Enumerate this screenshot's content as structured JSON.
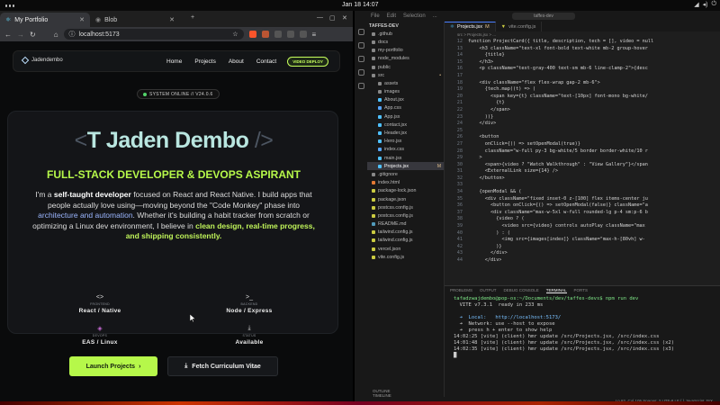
{
  "os": {
    "clock": "Jan 18  14:07"
  },
  "browser": {
    "tabs": [
      {
        "label": "My Portfolio",
        "active": true
      },
      {
        "label": "Blob",
        "active": false
      }
    ],
    "url": "localhost:5173"
  },
  "portfolio": {
    "logo_text": "Jadendembo",
    "nav": [
      "Home",
      "Projects",
      "About",
      "Contact"
    ],
    "nav_cta": "VIDEO DEPLOY",
    "status": "SYSTEM ONLINE // V24.0.6",
    "title_open": "<",
    "title_name": "T Jaden Dembo",
    "title_close": "/>",
    "subtitle": "FULL-STACK DEVELOPER & DEVOPS ASPIRANT",
    "desc": {
      "p1": "I'm a ",
      "b1": "self-taught developer",
      "p2": " focused on React and React Native. I build apps that people actually love using—moving beyond the \"Code Monkey\" phase into ",
      "l1": "architecture and automation",
      "p3": ". Whether it's building a habit tracker from scratch or optimizing a Linux dev environment, I believe in ",
      "g1": "clean design, real-time progress, and shipping consistently."
    },
    "stats": [
      {
        "icon": "<>",
        "category": "FRONTEND",
        "value": "React / Native"
      },
      {
        "icon": ">_",
        "category": "BACKEND",
        "value": "Node / Express"
      },
      {
        "icon": "◈",
        "category": "DEVOPS",
        "value": "EAS / Linux"
      },
      {
        "icon": "⤓",
        "category": "STATUS",
        "value": "Available"
      }
    ],
    "btn_launch": "Launch Projects",
    "btn_launch_arrow": "›",
    "btn_cv": "Fetch Curriculum Vitae",
    "btn_cv_icon": "⤓"
  },
  "editor": {
    "menu": [
      "File",
      "Edit",
      "Selection",
      "..."
    ],
    "command": "taffes-dev",
    "tabs": [
      {
        "label": "Projects.jsx",
        "badge": "M",
        "active": true
      },
      {
        "label": "vite.config.js",
        "badge": "",
        "active": false
      }
    ],
    "breadcrumb": "src > Projects.jsx > ...",
    "explorer_root": "TAFFES-DEV",
    "files": [
      {
        "name": ".github",
        "color": "#888",
        "mark": ""
      },
      {
        "name": "docs",
        "color": "#888",
        "mark": ""
      },
      {
        "name": "my-portfolio",
        "color": "#888",
        "mark": ""
      },
      {
        "name": "node_modules",
        "color": "#888",
        "mark": ""
      },
      {
        "name": "public",
        "color": "#888",
        "mark": ""
      },
      {
        "name": "src",
        "color": "#888",
        "mark": "•"
      },
      {
        "name": "assets",
        "color": "#888",
        "mark": ""
      },
      {
        "name": "images",
        "color": "#888",
        "mark": ""
      },
      {
        "name": "About.jsx",
        "color": "#4fc1ff",
        "mark": ""
      },
      {
        "name": "App.css",
        "color": "#56a5ff",
        "mark": ""
      },
      {
        "name": "App.jsx",
        "color": "#4fc1ff",
        "mark": ""
      },
      {
        "name": "contact.jsx",
        "color": "#4fc1ff",
        "mark": ""
      },
      {
        "name": "Header.jsx",
        "color": "#4fc1ff",
        "mark": ""
      },
      {
        "name": "Hero.jsx",
        "color": "#4fc1ff",
        "mark": ""
      },
      {
        "name": "index.css",
        "color": "#56a5ff",
        "mark": ""
      },
      {
        "name": "main.jsx",
        "color": "#4fc1ff",
        "mark": ""
      },
      {
        "name": "Projects.jsx",
        "color": "#4fc1ff",
        "mark": "M"
      },
      {
        "name": ".gitignore",
        "color": "#888",
        "mark": ""
      },
      {
        "name": "index.html",
        "color": "#e37933",
        "mark": ""
      },
      {
        "name": "package-lock.json",
        "color": "#cbcb41",
        "mark": ""
      },
      {
        "name": "package.json",
        "color": "#cbcb41",
        "mark": ""
      },
      {
        "name": "postcss.config.js",
        "color": "#cbcb41",
        "mark": ""
      },
      {
        "name": "postcss.config.js",
        "color": "#cbcb41",
        "mark": ""
      },
      {
        "name": "README.md",
        "color": "#519aba",
        "mark": ""
      },
      {
        "name": "tailwind.config.js",
        "color": "#cbcb41",
        "mark": ""
      },
      {
        "name": "tailwind.config.js",
        "color": "#cbcb41",
        "mark": ""
      },
      {
        "name": "vercel.json",
        "color": "#cbcb41",
        "mark": ""
      },
      {
        "name": "vite.config.js",
        "color": "#cbcb41",
        "mark": ""
      }
    ],
    "code": [
      {
        "n": "12",
        "t": "function ProjectCard({ title, description, tech = [], video = null"
      },
      {
        "n": "13",
        "t": "    <h3 className=\"text-xl font-bold text-white mb-2 group-hover"
      },
      {
        "n": "14",
        "t": "      {title}"
      },
      {
        "n": "15",
        "t": "    </h3>"
      },
      {
        "n": "16",
        "t": "    <p className=\"text-gray-400 text-sm mb-6 line-clamp-2\">{desc"
      },
      {
        "n": "17",
        "t": ""
      },
      {
        "n": "18",
        "t": "    <div className=\"flex flex-wrap gap-2 mb-6\">"
      },
      {
        "n": "19",
        "t": "      {tech.map((t) => ("
      },
      {
        "n": "20",
        "t": "        <span key={t} className=\"text-[10px] font-mono bg-white/"
      },
      {
        "n": "21",
        "t": "          {t}"
      },
      {
        "n": "22",
        "t": "        </span>"
      },
      {
        "n": "23",
        "t": "      ))}"
      },
      {
        "n": "24",
        "t": "    </div>"
      },
      {
        "n": "25",
        "t": ""
      },
      {
        "n": "26",
        "t": "    <button"
      },
      {
        "n": "27",
        "t": "      onClick={() => setOpenModal(true)}"
      },
      {
        "n": "28",
        "t": "      className=\"w-full py-3 bg-white/5 border border-white/10 r"
      },
      {
        "n": "29",
        "t": "    >"
      },
      {
        "n": "30",
        "t": "      <span>{video ? \"Watch Walkthrough\" : \"View Gallery\"}</span"
      },
      {
        "n": "31",
        "t": "      <ExternalLink size={14} />"
      },
      {
        "n": "32",
        "t": "    </button>"
      },
      {
        "n": "33",
        "t": ""
      },
      {
        "n": "34",
        "t": "    {openModal && ("
      },
      {
        "n": "35",
        "t": "      <div className=\"fixed inset-0 z-[100] flex items-center ju"
      },
      {
        "n": "36",
        "t": "        <button onClick={() => setOpenModal(false)} className=\"a"
      },
      {
        "n": "37",
        "t": "        <div className=\"max-w-5xl w-full rounded-lg p-4 sm:p-6 b"
      },
      {
        "n": "38",
        "t": "          {video ? ("
      },
      {
        "n": "39",
        "t": "            <video src={video} controls autoPlay className=\"max"
      },
      {
        "n": "40",
        "t": "          ) : ("
      },
      {
        "n": "41",
        "t": "            <img src={images[index]} className=\"max-h-[80vh] w-"
      },
      {
        "n": "42",
        "t": "          )}"
      },
      {
        "n": "43",
        "t": "        </div>"
      },
      {
        "n": "44",
        "t": "      </div>"
      }
    ],
    "panel_tabs": [
      "PROBLEMS",
      "OUTPUT",
      "DEBUG CONSOLE",
      "TERMINAL",
      "PORTS"
    ],
    "terminal": [
      "tafadzwajdembo@pop-os:~/Documents/dev/taffes-devs$ npm run dev",
      "  VITE v7.3.1  ready in 233 ms",
      "",
      "  ➜  Local:   http://localhost:5173/",
      "  ➜  Network: use --host to expose",
      "  ➜  press h + enter to show help",
      "14:02:25 [vite] (client) hmr update /src/Projects.jsx, /src/index.css",
      "14:01:48 [vite] (client) hmr update /src/Projects.jsx, /src/index.css (x2)",
      "14:02:35 [vite] (client) hmr update /src/Projects.jsx, /src/index.css (x3)",
      "█"
    ],
    "outline": [
      "OUTLINE",
      "TIMELINE"
    ],
    "statusbar": "Ln 82, Col 105   Spaces: 2   UTF-8   LF   { } JavaScript JSX"
  }
}
